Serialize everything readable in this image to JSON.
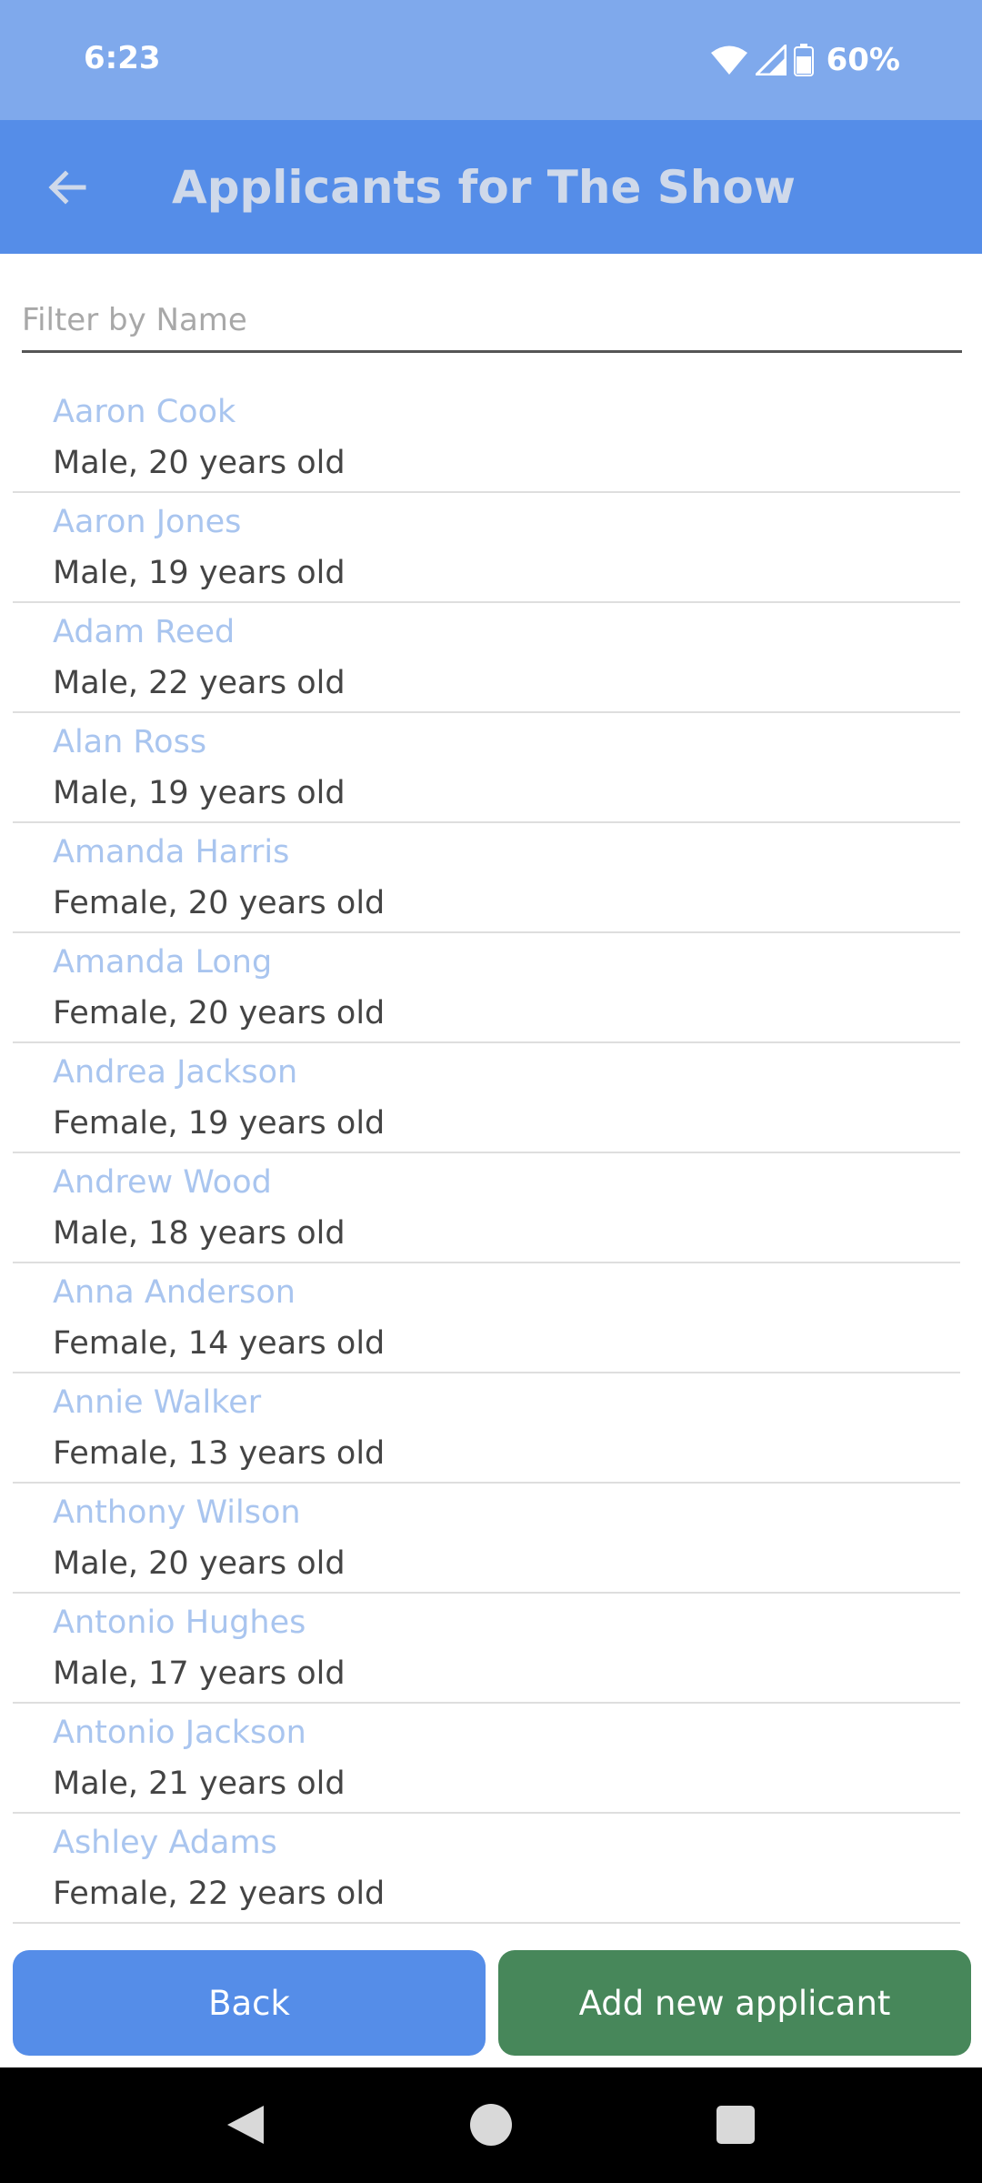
{
  "status_bar": {
    "time": "6:23",
    "battery": "60%",
    "icons": [
      "wifi-icon",
      "signal-icon",
      "battery-icon"
    ]
  },
  "app_bar": {
    "title": "Applicants for The Show",
    "back_icon": "arrow-left-icon"
  },
  "filter": {
    "placeholder": "Filter by Name",
    "value": ""
  },
  "applicants": [
    {
      "name": "Aaron Cook",
      "detail": "Male, 20 years old"
    },
    {
      "name": "Aaron Jones",
      "detail": "Male, 19 years old"
    },
    {
      "name": "Adam Reed",
      "detail": "Male, 22 years old"
    },
    {
      "name": "Alan Ross",
      "detail": "Male, 19 years old"
    },
    {
      "name": "Amanda Harris",
      "detail": "Female, 20 years old"
    },
    {
      "name": "Amanda Long",
      "detail": "Female, 20 years old"
    },
    {
      "name": "Andrea Jackson",
      "detail": "Female, 19 years old"
    },
    {
      "name": "Andrew Wood",
      "detail": "Male, 18 years old"
    },
    {
      "name": "Anna Anderson",
      "detail": "Female, 14 years old"
    },
    {
      "name": "Annie Walker",
      "detail": "Female, 13 years old"
    },
    {
      "name": "Anthony Wilson",
      "detail": "Male, 20 years old"
    },
    {
      "name": "Antonio Hughes",
      "detail": "Male, 17 years old"
    },
    {
      "name": "Antonio Jackson",
      "detail": "Male, 21 years old"
    },
    {
      "name": "Ashley Adams",
      "detail": "Female, 22 years old"
    }
  ],
  "buttons": {
    "back_label": "Back",
    "add_label": "Add new applicant"
  },
  "colors": {
    "status_bar": "#7fa9ec",
    "app_bar": "#558de8",
    "back_button": "#558de8",
    "add_button": "#47875a",
    "name_text": "#a9c5ef"
  },
  "nav_bar": {
    "icons": [
      "nav-back-icon",
      "nav-home-icon",
      "nav-recents-icon"
    ]
  }
}
